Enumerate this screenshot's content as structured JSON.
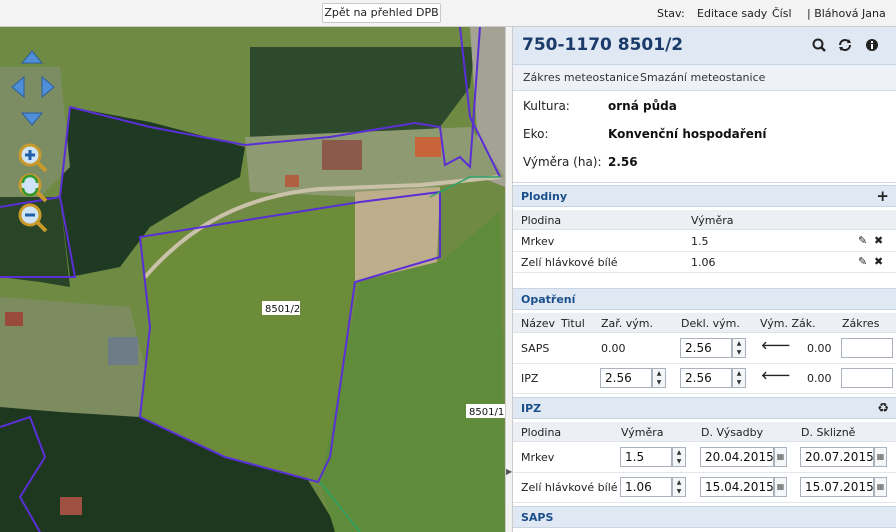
{
  "topbar": {
    "back_label": "Zpět na přehled DPB",
    "status_label": "Stav:",
    "edit_label": "Editace sady",
    "cislo_label": "Čísl",
    "user_label": "| Bláhová Jana"
  },
  "map": {
    "parcel_label_main": "8501/2",
    "parcel_label_right": "8501/1"
  },
  "panel": {
    "title": "750-1170 8501/2",
    "tabs": [
      "Zákres meteostanice",
      "Smazání meteostanice"
    ],
    "info": {
      "kultura_label": "Kultura:",
      "kultura_value": "orná půda",
      "eko_label": "Eko:",
      "eko_value": "Konvenční hospodaření",
      "vymera_label": "Výměra (ha):",
      "vymera_value": "2.56"
    },
    "plodiny": {
      "title": "Plodiny",
      "col_plodina": "Plodina",
      "col_vymera": "Výměra",
      "rows": [
        {
          "name": "Mrkev",
          "vymera": "1.5"
        },
        {
          "name": "Zelí hlávkové bílé",
          "vymera": "1.06"
        }
      ]
    },
    "opatreni": {
      "title": "Opatření",
      "cols": {
        "nazev": "Název",
        "titul": "Titul",
        "zar": "Zař. vým.",
        "dekl": "Dekl. vým.",
        "vymzak": "Vým. Zák.",
        "zakres": "Zákres"
      },
      "rows": [
        {
          "name": "SAPS",
          "zar": "0.00",
          "dekl": "2.56",
          "vymzak": "0.00"
        },
        {
          "name": "IPZ",
          "zar": "2.56",
          "dekl": "2.56",
          "vymzak": "0.00"
        }
      ]
    },
    "ipz": {
      "title": "IPZ",
      "cols": {
        "plodina": "Plodina",
        "vymera": "Výměra",
        "vysadby": "D. Výsadby",
        "sklizne": "D. Sklizně"
      },
      "rows": [
        {
          "name": "Mrkev",
          "vymera": "1.5",
          "vysadby": "20.04.2015",
          "sklizne": "20.07.2015"
        },
        {
          "name": "Zelí hlávkové bílé",
          "vymera": "1.06",
          "vysadby": "15.04.2015",
          "sklizne": "15.07.2015"
        }
      ]
    },
    "saps": {
      "title": "SAPS"
    }
  },
  "colors": {
    "parcel_border": "#5a2fd6",
    "section_title": "#1b4f8c",
    "accept_arrow": "#1d7d1d"
  }
}
